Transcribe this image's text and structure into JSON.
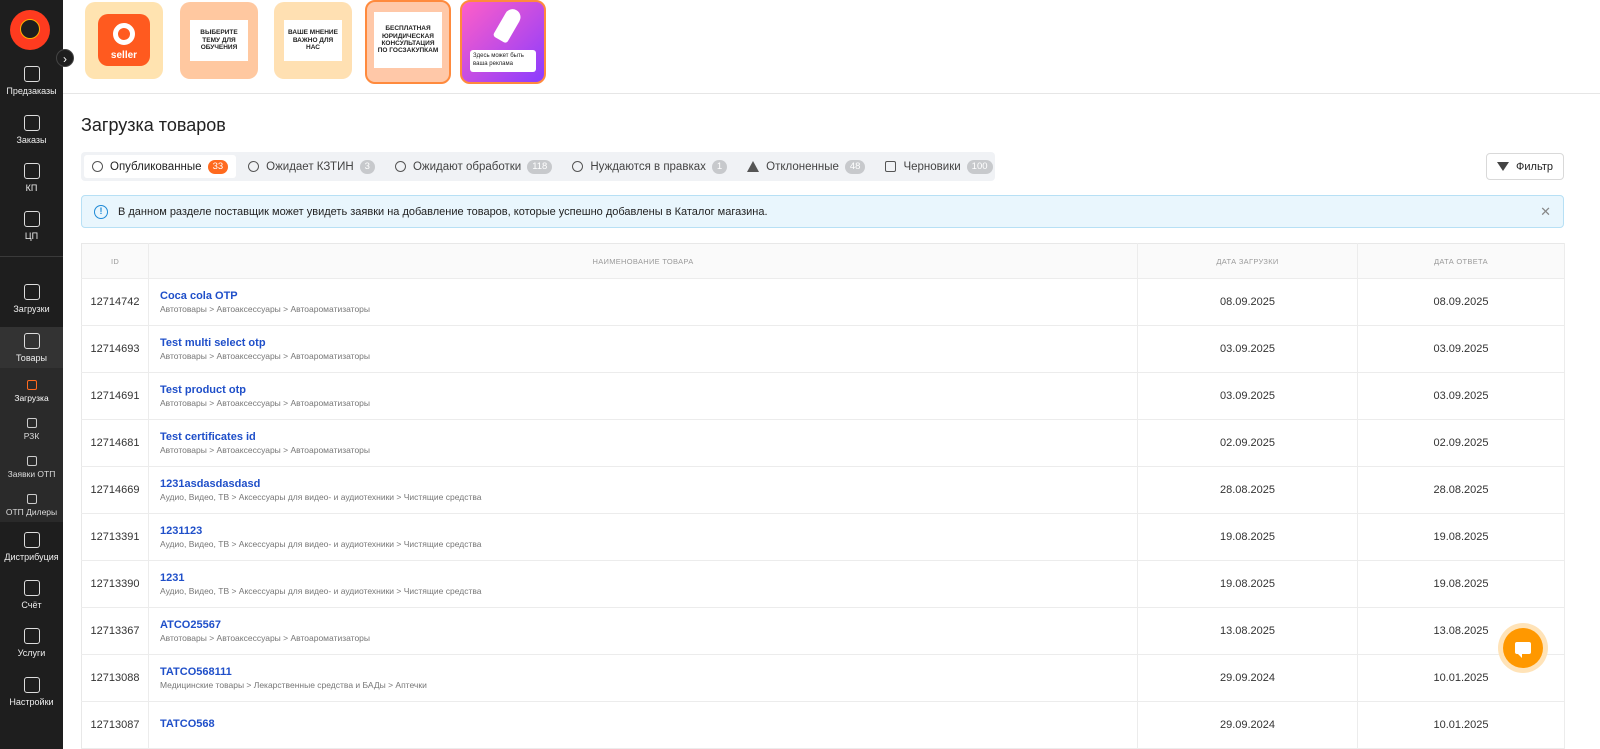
{
  "sidebar": {
    "items": [
      {
        "label": "Предзаказы",
        "icon": "preorder-icon"
      },
      {
        "label": "Заказы",
        "icon": "orders-icon"
      },
      {
        "label": "КП",
        "icon": "document-icon"
      },
      {
        "label": "ЦП",
        "icon": "bag-icon"
      },
      {
        "label": "Загрузки",
        "icon": "upload-icon"
      },
      {
        "label": "Товары",
        "icon": "goods-icon"
      },
      {
        "label": "Дистрибуция",
        "icon": "store-icon"
      },
      {
        "label": "Счёт",
        "icon": "bank-icon"
      },
      {
        "label": "Услуги",
        "icon": "services-icon"
      },
      {
        "label": "Настройки",
        "icon": "settings-icon"
      }
    ],
    "subitems": [
      {
        "label": "Загрузка"
      },
      {
        "label": "РЗК"
      },
      {
        "label": "Заявки ОТП"
      },
      {
        "label": "ОТП Дилеры"
      }
    ]
  },
  "banners": {
    "b1": "seller",
    "b2": "ВЫБЕРИТЕ ТЕМУ ДЛЯ ОБУЧЕНИЯ",
    "b3": "ВАШЕ МНЕНИЕ ВАЖНО ДЛЯ НАС",
    "b4": "БЕСПЛАТНАЯ ЮРИДИЧЕСКАЯ КОНСУЛЬТАЦИЯ ПО ГОСЗАКУПКАМ",
    "b5": "Здесь может быть ваша реклама"
  },
  "page": {
    "title": "Загрузка товаров"
  },
  "tabs": [
    {
      "label": "Опубликованные",
      "count": "33"
    },
    {
      "label": "Ожидает КЗТИН",
      "count": "3"
    },
    {
      "label": "Ожидают обработки",
      "count": "118"
    },
    {
      "label": "Нуждаются в правках",
      "count": "1"
    },
    {
      "label": "Отклоненные",
      "count": "48"
    },
    {
      "label": "Черновики",
      "count": "100"
    }
  ],
  "filter": {
    "label": "Фильтр"
  },
  "alert": {
    "text": "В данном разделе поставщик может увидеть заявки на добавление товаров, которые успешно добавлены в Каталог магазина.",
    "close": "✕"
  },
  "table": {
    "headers": [
      "ID",
      "Наименование товара",
      "Дата загрузки",
      "Дата ответа"
    ],
    "rows": [
      {
        "id": "12714742",
        "name": "Coca cola OTP",
        "category": "Автотовары > Автоаксессуары > Автоароматизаторы",
        "uploaded": "08.09.2025",
        "answered": "08.09.2025"
      },
      {
        "id": "12714693",
        "name": "Test multi select otp",
        "category": "Автотовары > Автоаксессуары > Автоароматизаторы",
        "uploaded": "03.09.2025",
        "answered": "03.09.2025"
      },
      {
        "id": "12714691",
        "name": "Test product otp",
        "category": "Автотовары > Автоаксессуары > Автоароматизаторы",
        "uploaded": "03.09.2025",
        "answered": "03.09.2025"
      },
      {
        "id": "12714681",
        "name": "Test certificates id",
        "category": "Автотовары > Автоаксессуары > Автоароматизаторы",
        "uploaded": "02.09.2025",
        "answered": "02.09.2025"
      },
      {
        "id": "12714669",
        "name": "1231asdasdasdasd",
        "category": "Аудио, Видео, ТВ > Аксессуары для видео- и аудиотехники > Чистящие средства",
        "uploaded": "28.08.2025",
        "answered": "28.08.2025"
      },
      {
        "id": "12713391",
        "name": "1231123",
        "category": "Аудио, Видео, ТВ > Аксессуары для видео- и аудиотехники > Чистящие средства",
        "uploaded": "19.08.2025",
        "answered": "19.08.2025"
      },
      {
        "id": "12713390",
        "name": "1231",
        "category": "Аудио, Видео, ТВ > Аксессуары для видео- и аудиотехники > Чистящие средства",
        "uploaded": "19.08.2025",
        "answered": "19.08.2025"
      },
      {
        "id": "12713367",
        "name": "ATCO25567",
        "category": "Автотовары > Автоаксессуары > Автоароматизаторы",
        "uploaded": "13.08.2025",
        "answered": "13.08.2025"
      },
      {
        "id": "12713088",
        "name": "TATCO568111",
        "category": "Медицинские товары > Лекарственные средства и БАДы > Аптечки",
        "uploaded": "29.09.2024",
        "answered": "10.01.2025"
      },
      {
        "id": "12713087",
        "name": "TATCO568",
        "category": "",
        "uploaded": "29.09.2024",
        "answered": "10.01.2025"
      }
    ]
  },
  "colors": {
    "accent": "#ff6a1f",
    "link": "#1f4fc9",
    "chat": "#ff9800"
  }
}
